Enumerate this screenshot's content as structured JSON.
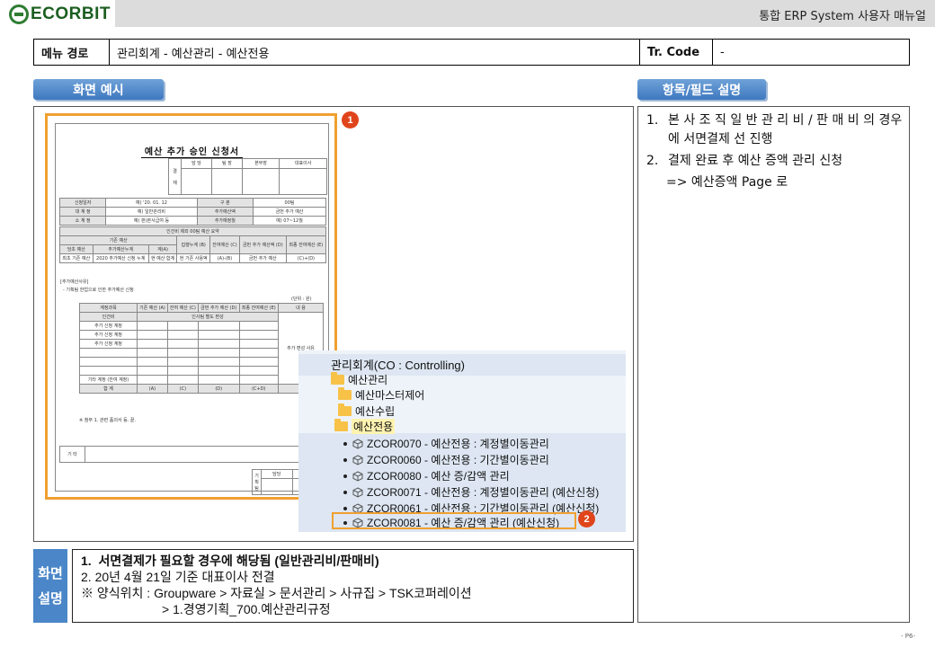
{
  "header": {
    "logo_text": "ECORBIT",
    "manual_title": "통합 ERP System 사용자 매뉴얼"
  },
  "path_row": {
    "menu_path_label": "메뉴 경로",
    "menu_path_value": "관리회계 - 예산관리 - 예산전용",
    "tr_code_label": "Tr. Code",
    "tr_code_value": "-"
  },
  "tabs": {
    "screen_example": "화면 예시",
    "field_desc": "항목/필드 설명"
  },
  "form": {
    "title": "예산 추가 승인 신청서",
    "approval_col": [
      "결",
      "재"
    ],
    "approval_heads": [
      "담 당",
      "팀 장",
      "본부장",
      "대표이사"
    ],
    "info_rows": [
      [
        "신청일자",
        "예) '20. 01. 12",
        "구 분",
        "00팀"
      ],
      [
        "대 계 정",
        "예) 일반관리비",
        "추가예산액",
        "금번 추가 예산"
      ],
      [
        "소 계 정",
        "예) 판)본사급여 등",
        "추가예정월",
        "예) 07~12월"
      ]
    ],
    "summary_head": "인건비 제외 00팀 예산 요약",
    "summary_cols": [
      "기존 예산",
      "집행누계 (B)",
      "잔여예산 (C)",
      "금번 추가 예산액 (D)",
      "최종 잔여예산 (E)"
    ],
    "summary_sub": [
      "당초 예산",
      "추가예산누계",
      "계(A)"
    ],
    "summary_vals": [
      "최초 기존 예산",
      "2020 추가예산 신청 누계",
      "현 예산 합계",
      "현 기존 사용액",
      "(A)-(B)",
      "금번 추가 예산",
      "(C)+(D)"
    ],
    "reason_title": "[추가예산사유]",
    "reason_text": "- 기획팀 한업으로 인한 추가예산 신청",
    "unit": "(단위 : 원)",
    "detail_cols": [
      "계정과목",
      "기존 예산 (A)",
      "잔여 예산 (C)",
      "금번 추가 예산 (D)",
      "최종 잔여예산 (E)",
      "내 용"
    ],
    "detail_rows": [
      "인건비",
      "추가 신청 계정",
      "추가 신청 계정",
      "추가 신청 계정",
      "",
      "",
      "",
      "기타 계정 (잔여 계정)",
      "합 계"
    ],
    "detail_note": "인사팀 별도 편성",
    "detail_content": "추가 편성 사유",
    "detail_total": [
      "(A)",
      "(C)",
      "(D)",
      "(C+D)"
    ],
    "attach": "※ 첨부 1. 관련 품의서 등.  끝.",
    "etc_label": "기    타",
    "sign_heads": [
      "담당",
      "팀장"
    ],
    "sign_label": "기획팀"
  },
  "tree": {
    "root": "관리회계(CO : Controlling)",
    "level1": "예산관리",
    "folders": [
      "예산마스터제어",
      "예산수립",
      "예산전용"
    ],
    "items": [
      "ZCOR0070 - 예산전용 : 계정별이동관리",
      "ZCOR0060 - 예산전용 : 기간별이동관리",
      "ZCOR0080 - 예산 증/감액 관리",
      "ZCOR0071 - 예산전용 : 계정별이동관리 (예산신청)",
      "ZCOR0061 - 예산전용 : 기간별이동관리 (예산신청)",
      "ZCOR0081 - 예산 증/감액 관리 (예산신청)"
    ]
  },
  "badges": [
    "1",
    "2"
  ],
  "desc": {
    "items": [
      {
        "num": "1.",
        "text": "본 사 조 직   일 반 관 리 비 / 판 매 비 의 경우에 서면결제 선 진행"
      },
      {
        "num": "2.",
        "text": "결제 완료 후   예산 증액 관리 신청"
      }
    ],
    "sub": "=> 예산증액 Page 로"
  },
  "explain": {
    "label_1": "화면",
    "label_2": "설명",
    "line1_num": "1.",
    "line1": "서면결제가 필요할 경우에 해당됨 (일반관리비/판매비)",
    "line2": "2.  20년 4월 21일 기준 대표이사 전결",
    "line3": "※ 양식위치 : Groupware > 자료실 > 문서관리 > 사규집 > TSK코퍼레이션",
    "line4": "> 1.경영기획_700.예산관리규정"
  },
  "page_no": "- P6-",
  "colors": {
    "tab_blue": "#4a86c8",
    "highlight_orange": "#f0a030",
    "badge_red": "#e0441b",
    "logo_green": "#2e7d32"
  }
}
